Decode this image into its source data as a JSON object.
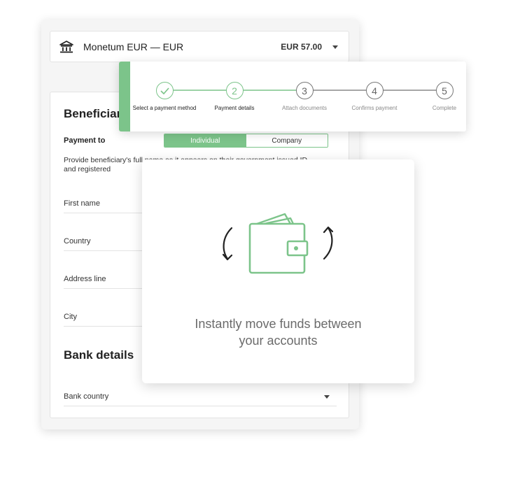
{
  "account": {
    "icon": "bank-icon",
    "name": "Monetum EUR — EUR",
    "balance": "EUR 57.00"
  },
  "stepper": {
    "steps": [
      {
        "number": "",
        "label": "Select a payment method",
        "state": "done",
        "icon": "check-icon"
      },
      {
        "number": "2",
        "label": "Payment details",
        "state": "current"
      },
      {
        "number": "3",
        "label": "Attach documents",
        "state": "todo"
      },
      {
        "number": "4",
        "label": "Confirms payment",
        "state": "todo"
      },
      {
        "number": "5",
        "label": "Complete",
        "state": "todo"
      }
    ]
  },
  "beneficiary": {
    "title": "Beneficiary",
    "payment_to_label": "Payment to",
    "toggle": {
      "individual": "Individual",
      "company": "Company",
      "selected": "Individual"
    },
    "help_text": "Provide beneficiary's full name as it appears on their government issued ID and registered",
    "fields": {
      "first_name": "First name",
      "country": "Country",
      "address_line": "Address line",
      "city": "City"
    }
  },
  "bank_details": {
    "title": "Bank details",
    "bank_country": "Bank country"
  },
  "promo": {
    "icon": "wallet-transfer-icon",
    "line1": "Instantly move funds between",
    "line2": "your accounts"
  },
  "colors": {
    "accent": "#7cc48a",
    "card_bg": "#f5f5f5",
    "text": "#333333"
  }
}
